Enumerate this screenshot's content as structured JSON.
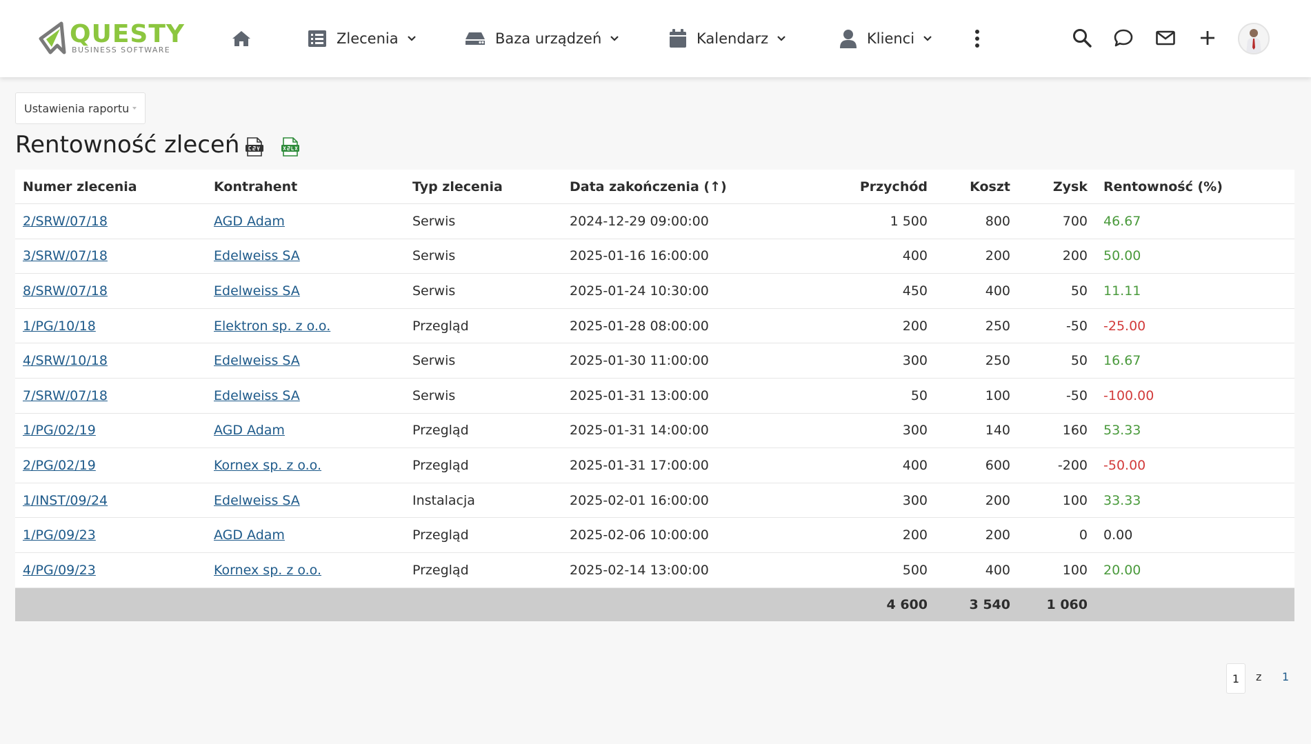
{
  "logo": {
    "word": "QUESTY",
    "sub": "BUSINESS SOFTWARE"
  },
  "nav": {
    "items": [
      {
        "label": "Zlecenia"
      },
      {
        "label": "Baza urządzeń"
      },
      {
        "label": "Kalendarz"
      },
      {
        "label": "Klienci"
      }
    ]
  },
  "report": {
    "settings_label": "Ustawienia raportu",
    "title": "Rentowność zleceń"
  },
  "table": {
    "headers": {
      "order": "Numer zlecenia",
      "client": "Kontrahent",
      "type": "Typ zlecenia",
      "date": "Data zakończenia (↑)",
      "revenue": "Przychód",
      "cost": "Koszt",
      "profit": "Zysk",
      "margin": "Rentowność (%)"
    },
    "rows": [
      {
        "order": "2/SRW/07/18",
        "client": "AGD Adam",
        "type": "Serwis",
        "date": "2024-12-29 09:00:00",
        "revenue": "1 500",
        "cost": "800",
        "profit": "700",
        "margin": "46.67"
      },
      {
        "order": "3/SRW/07/18",
        "client": "Edelweiss SA",
        "type": "Serwis",
        "date": "2025-01-16 16:00:00",
        "revenue": "400",
        "cost": "200",
        "profit": "200",
        "margin": "50.00"
      },
      {
        "order": "8/SRW/07/18",
        "client": "Edelweiss SA",
        "type": "Serwis",
        "date": "2025-01-24 10:30:00",
        "revenue": "450",
        "cost": "400",
        "profit": "50",
        "margin": "11.11"
      },
      {
        "order": "1/PG/10/18",
        "client": "Elektron sp. z o.o.",
        "type": "Przegląd",
        "date": "2025-01-28 08:00:00",
        "revenue": "200",
        "cost": "250",
        "profit": "-50",
        "margin": "-25.00"
      },
      {
        "order": "4/SRW/10/18",
        "client": "Edelweiss SA",
        "type": "Serwis",
        "date": "2025-01-30 11:00:00",
        "revenue": "300",
        "cost": "250",
        "profit": "50",
        "margin": "16.67"
      },
      {
        "order": "7/SRW/07/18",
        "client": "Edelweiss SA",
        "type": "Serwis",
        "date": "2025-01-31 13:00:00",
        "revenue": "50",
        "cost": "100",
        "profit": "-50",
        "margin": "-100.00"
      },
      {
        "order": "1/PG/02/19",
        "client": "AGD Adam",
        "type": "Przegląd",
        "date": "2025-01-31 14:00:00",
        "revenue": "300",
        "cost": "140",
        "profit": "160",
        "margin": "53.33"
      },
      {
        "order": "2/PG/02/19",
        "client": "Kornex sp. z o.o.",
        "type": "Przegląd",
        "date": "2025-01-31 17:00:00",
        "revenue": "400",
        "cost": "600",
        "profit": "-200",
        "margin": "-50.00"
      },
      {
        "order": "1/INST/09/24",
        "client": "Edelweiss SA",
        "type": "Instalacja",
        "date": "2025-02-01 16:00:00",
        "revenue": "300",
        "cost": "200",
        "profit": "100",
        "margin": "33.33"
      },
      {
        "order": "1/PG/09/23",
        "client": "AGD Adam",
        "type": "Przegląd",
        "date": "2025-02-06 10:00:00",
        "revenue": "200",
        "cost": "200",
        "profit": "0",
        "margin": "0.00"
      },
      {
        "order": "4/PG/09/23",
        "client": "Kornex sp. z o.o.",
        "type": "Przegląd",
        "date": "2025-02-14 13:00:00",
        "revenue": "500",
        "cost": "400",
        "profit": "100",
        "margin": "20.00"
      }
    ],
    "totals": {
      "revenue": "4 600",
      "cost": "3 540",
      "profit": "1 060"
    }
  },
  "pagination": {
    "current": "1",
    "of": "z",
    "total": "1"
  },
  "colors": {
    "brand_green": "#8cc63f",
    "link": "#1e5a8a",
    "positive": "#4a9a3c",
    "negative": "#d23b3b",
    "totals_bg": "#cccccc"
  }
}
